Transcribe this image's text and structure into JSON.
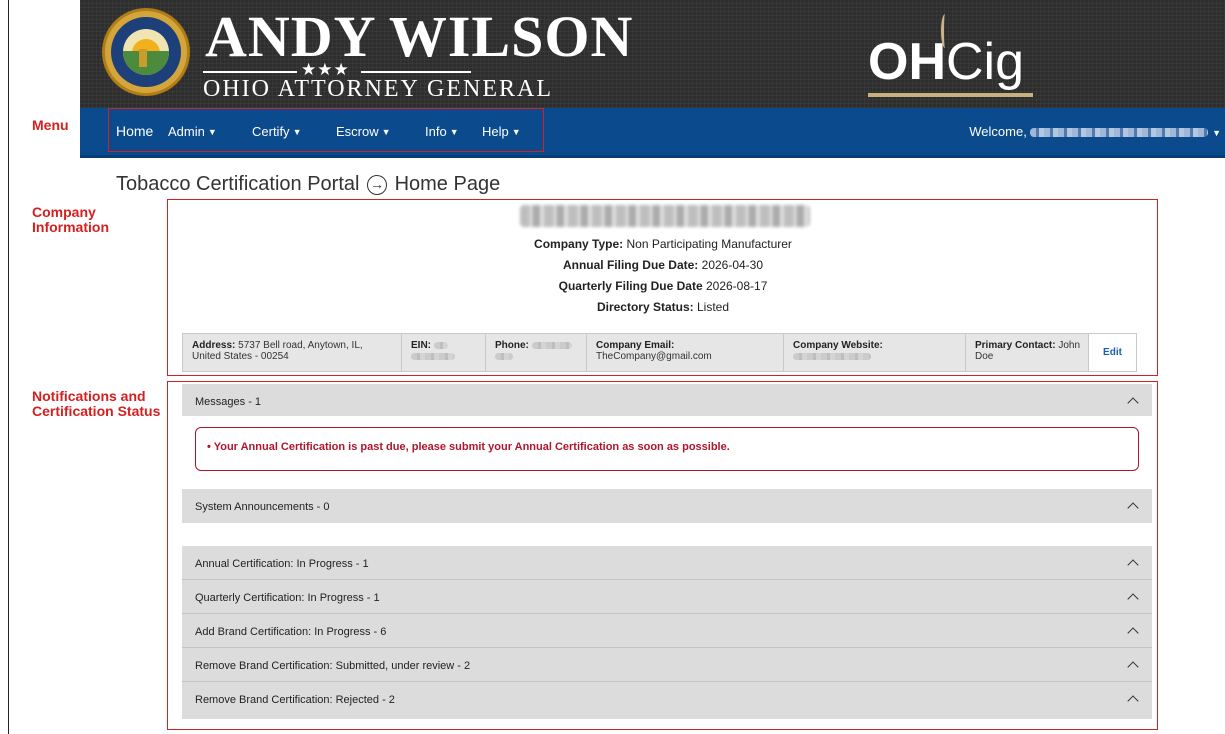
{
  "brand": {
    "official_name": "ANDY WILSON",
    "office": "OHIO ATTORNEY GENERAL",
    "stars": "★★★",
    "app_logo_bold": "OH",
    "app_logo_light": "Cig"
  },
  "nav": {
    "items": [
      {
        "label": "Home"
      },
      {
        "label": "Admin"
      },
      {
        "label": "Certify"
      },
      {
        "label": "Escrow"
      },
      {
        "label": "Info"
      },
      {
        "label": "Help"
      }
    ],
    "caret": "▼",
    "welcome": "Welcome,"
  },
  "annotations": {
    "menu": "Menu",
    "company": "Company Information",
    "notifications": "Notifications and Certification Status"
  },
  "page": {
    "title_left": "Tobacco Certification Portal",
    "title_sep": "→",
    "title_right": "Home Page"
  },
  "company": {
    "type_label": "Company Type:",
    "type_value": "Non Participating Manufacturer",
    "annual_label": "Annual Filing Due Date:",
    "annual_value": "2026-04-30",
    "quarterly_label": "Quarterly Filing Due Date",
    "quarterly_value": "2026-08-17",
    "directory_label": "Directory Status:",
    "directory_value": "Listed",
    "address_label": "Address:",
    "address_value": "5737 Bell road, Anytown, IL, United States - 00254",
    "ein_label": "EIN:",
    "phone_label": "Phone:",
    "email_label": "Company Email:",
    "email_value": "TheCompany@gmail.com",
    "website_label": "Company Website:",
    "contact_label": "Primary Contact:",
    "contact_value": "John Doe",
    "edit": "Edit"
  },
  "notifications": {
    "messages": "Messages - 1",
    "alert": "• Your Annual Certification is past due, please submit your Annual Certification as soon as possible.",
    "system": "System Announcements - 0",
    "statuses": [
      "Annual Certification: In Progress - 1",
      "Quarterly Certification: In Progress - 1",
      "Add Brand Certification: In Progress - 6",
      "Remove Brand Certification: Submitted, under review - 2",
      "Remove Brand Certification: Rejected - 2"
    ]
  },
  "colors": {
    "nav_blue": "#0b4a8c",
    "annotation_red": "#d42020",
    "alert_red": "#b0162a",
    "accordion_gray": "#dcdcdc"
  }
}
